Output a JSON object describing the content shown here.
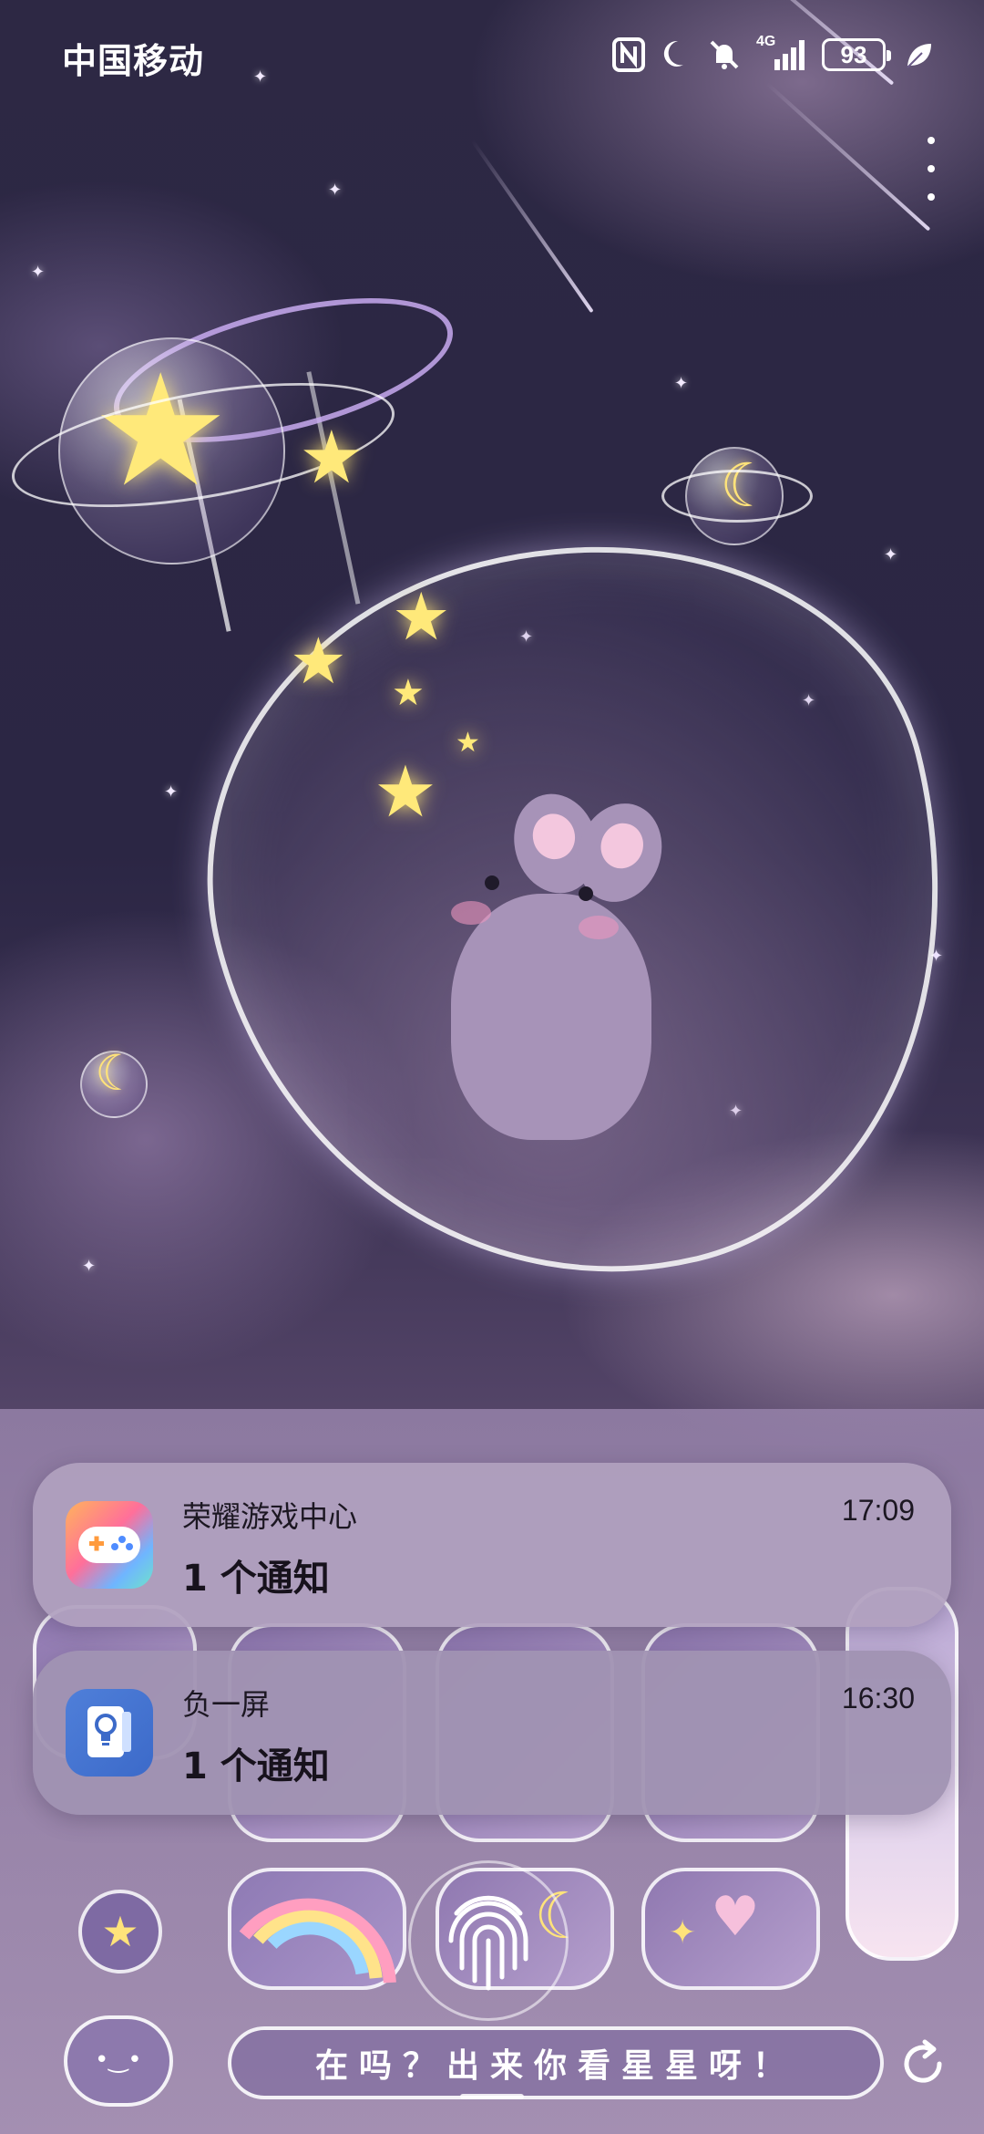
{
  "status_bar": {
    "carrier": "中国移动",
    "network": "4G",
    "battery_level": "93",
    "icons": [
      "nfc-icon",
      "moon-do-not-disturb-icon",
      "bell-muted-icon",
      "signal-icon",
      "battery-icon",
      "leaf-eco-icon"
    ]
  },
  "header_menu": {
    "icon": "more-vertical-icon"
  },
  "notifications": [
    {
      "app_name": "荣耀游戏中心",
      "time": "17:09",
      "message": "1 个通知",
      "icon": "gamepad-icon",
      "icon_colors": [
        "#ffb35c",
        "#ff6f9a",
        "#6fb5ff",
        "#6fe3c9"
      ]
    },
    {
      "app_name": "负一屏",
      "time": "16:30",
      "message": "1 个通知",
      "icon": "lightbulb-card-icon",
      "icon_colors": [
        "#4f7fd9",
        "#3c6ac9"
      ]
    }
  ],
  "widget": {
    "message_text": "在吗？出来你看星星呀！",
    "icons": [
      "star-button-icon",
      "rainbow-icon",
      "fingerprint-icon",
      "magic-wand-icon",
      "refresh-icon",
      "cloud-face-icon"
    ]
  },
  "theme": {
    "sky": "#2b2644",
    "accent_star": "#ffe97a",
    "bunny": "#a793b8"
  }
}
